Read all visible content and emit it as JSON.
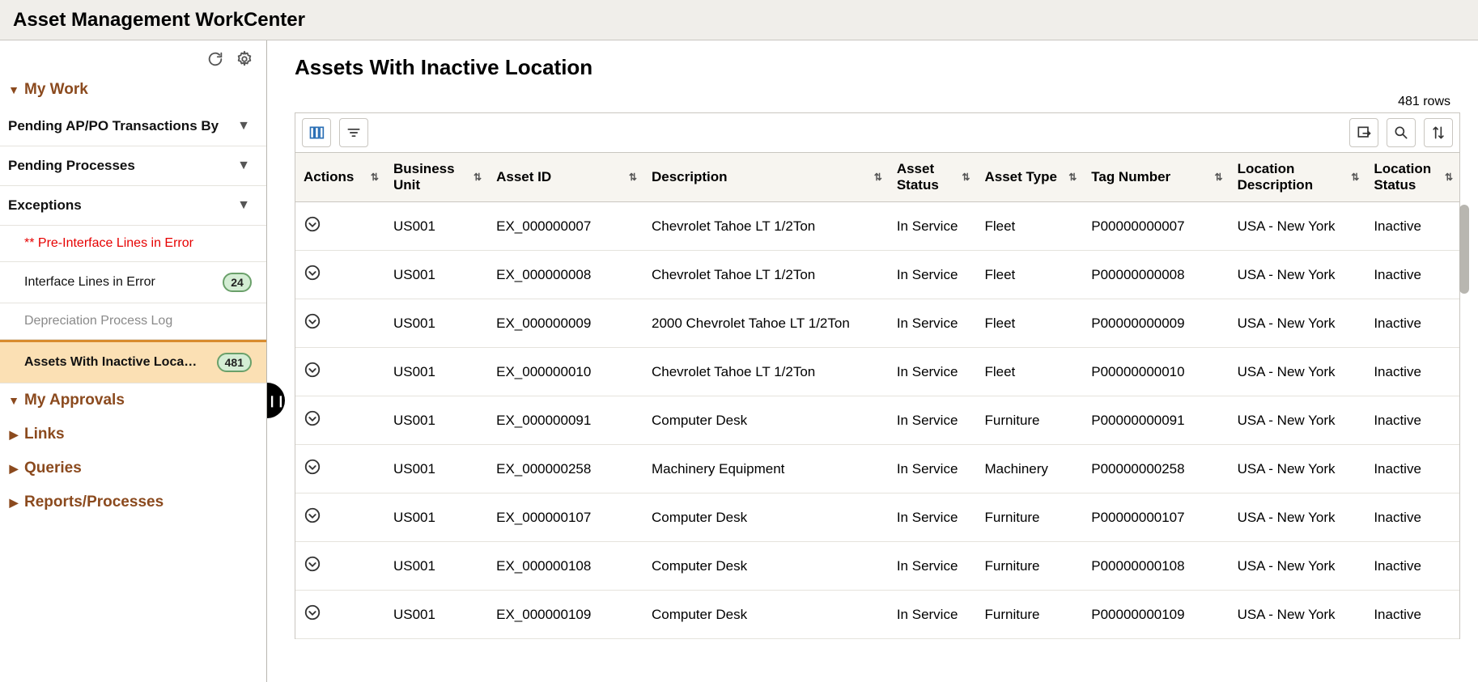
{
  "app_title": "Asset Management WorkCenter",
  "sidebar": {
    "sections": {
      "my_work": "My Work",
      "my_approvals": "My Approvals",
      "links": "Links",
      "queries": "Queries",
      "reports": "Reports/Processes"
    },
    "my_work_items": {
      "pending_ap_po": "Pending AP/PO Transactions By",
      "pending_processes": "Pending Processes",
      "exceptions": "Exceptions"
    },
    "exceptions_items": {
      "pre_interface": "** Pre-Interface Lines in Error",
      "interface": "Interface Lines in Error",
      "interface_count": "24",
      "depr_log": "Depreciation Process Log",
      "inactive_loc": "Assets With Inactive Loca…",
      "inactive_loc_count": "481"
    },
    "icons": {
      "refresh": "refresh-icon",
      "gear": "gear-icon"
    }
  },
  "main": {
    "title": "Assets With Inactive Location",
    "row_count_label": "481 rows",
    "toolbar_icons": {
      "columns": "columns-icon",
      "filter": "filter-icon",
      "export": "export-icon",
      "search": "search-icon",
      "sort": "sort-icon"
    },
    "columns": {
      "actions": "Actions",
      "business_unit": "Business Unit",
      "asset_id": "Asset ID",
      "description": "Description",
      "asset_status": "Asset Status",
      "asset_type": "Asset Type",
      "tag_number": "Tag Number",
      "location_description": "Location Description",
      "location_status": "Location Status"
    },
    "rows": [
      {
        "bu": "US001",
        "id": "EX_000000007",
        "desc": "Chevrolet Tahoe LT 1/2Ton",
        "status": "In Service",
        "type": "Fleet",
        "tag": "P00000000007",
        "loc": "USA - New York",
        "lstat": "Inactive"
      },
      {
        "bu": "US001",
        "id": "EX_000000008",
        "desc": "Chevrolet Tahoe LT 1/2Ton",
        "status": "In Service",
        "type": "Fleet",
        "tag": "P00000000008",
        "loc": "USA - New York",
        "lstat": "Inactive"
      },
      {
        "bu": "US001",
        "id": "EX_000000009",
        "desc": "2000 Chevrolet Tahoe LT 1/2Ton",
        "status": "In Service",
        "type": "Fleet",
        "tag": "P00000000009",
        "loc": "USA - New York",
        "lstat": "Inactive"
      },
      {
        "bu": "US001",
        "id": "EX_000000010",
        "desc": "Chevrolet Tahoe LT 1/2Ton",
        "status": "In Service",
        "type": "Fleet",
        "tag": "P00000000010",
        "loc": "USA - New York",
        "lstat": "Inactive"
      },
      {
        "bu": "US001",
        "id": "EX_000000091",
        "desc": "Computer Desk",
        "status": "In Service",
        "type": "Furniture",
        "tag": "P00000000091",
        "loc": "USA - New York",
        "lstat": "Inactive"
      },
      {
        "bu": "US001",
        "id": "EX_000000258",
        "desc": "Machinery Equipment",
        "status": "In Service",
        "type": "Machinery",
        "tag": "P00000000258",
        "loc": "USA - New York",
        "lstat": "Inactive"
      },
      {
        "bu": "US001",
        "id": "EX_000000107",
        "desc": "Computer Desk",
        "status": "In Service",
        "type": "Furniture",
        "tag": "P00000000107",
        "loc": "USA - New York",
        "lstat": "Inactive"
      },
      {
        "bu": "US001",
        "id": "EX_000000108",
        "desc": "Computer Desk",
        "status": "In Service",
        "type": "Furniture",
        "tag": "P00000000108",
        "loc": "USA - New York",
        "lstat": "Inactive"
      },
      {
        "bu": "US001",
        "id": "EX_000000109",
        "desc": "Computer Desk",
        "status": "In Service",
        "type": "Furniture",
        "tag": "P00000000109",
        "loc": "USA - New York",
        "lstat": "Inactive"
      }
    ]
  }
}
